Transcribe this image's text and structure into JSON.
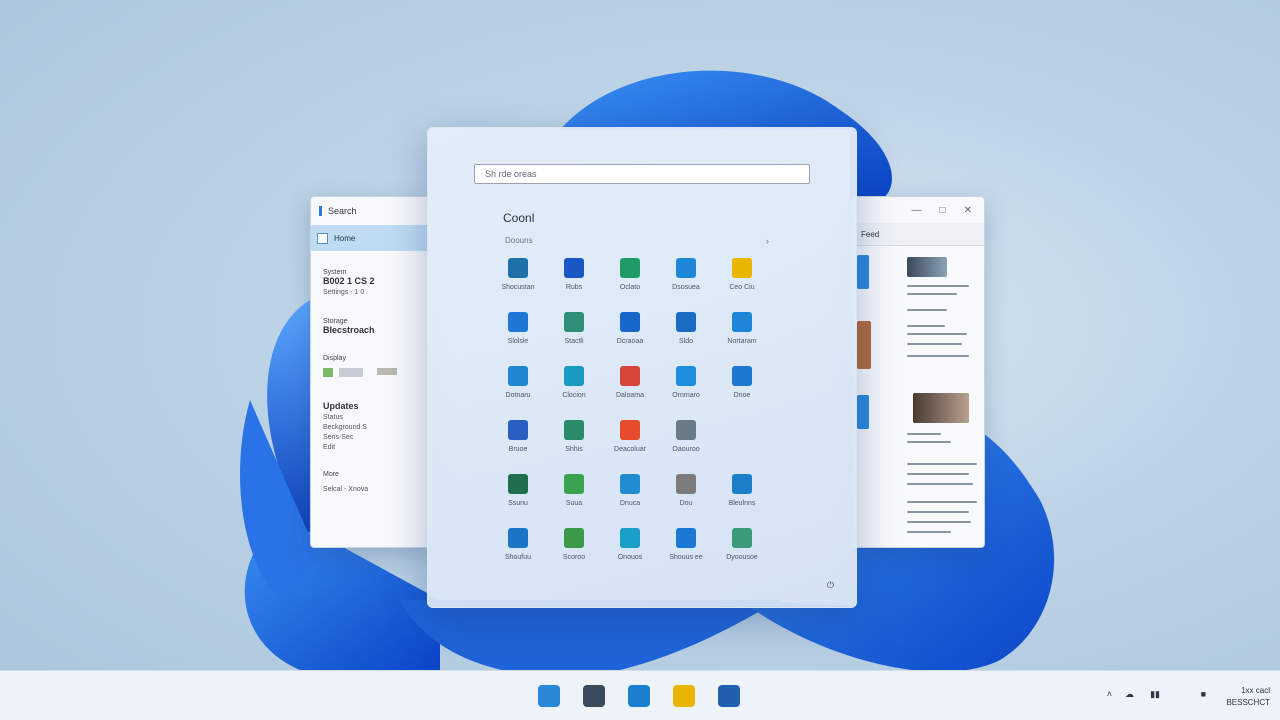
{
  "left_window": {
    "title": "Search",
    "selected_item": "Home",
    "section1_label": "System",
    "section1_value": "B002 1 CS 2",
    "section1_detail": "Settings - 1 0",
    "section2_label": "Storage",
    "section2_value": "Blecstroach",
    "section3_label": "Display",
    "section4_label": "Updates",
    "section4_lines": [
      "Status",
      "Beckground S",
      "Sens-Sec",
      "Edit"
    ],
    "section5_label": "More",
    "footer_text": "Selcal - Xnova"
  },
  "right_window": {
    "tab_label": "Feed",
    "controls": [
      "—",
      "□",
      "✕"
    ]
  },
  "start_menu": {
    "search_placeholder": "Sh rde oreas",
    "pinned_title": "Coonl",
    "pinned_subtitle": "Doouns",
    "all_apps": "›",
    "apps": [
      {
        "label": "Shocustan",
        "color": "#1f6fa8",
        "icon": "store-icon"
      },
      {
        "label": "Rubs",
        "color": "#1b57c4",
        "icon": "grid-icon"
      },
      {
        "label": "Oclato",
        "color": "#1f9a67",
        "icon": "photos-icon"
      },
      {
        "label": "Dsosuea",
        "color": "#1e86d6",
        "icon": "star-icon"
      },
      {
        "label": "Ceo Ciu",
        "color": "#e9b500",
        "icon": "folder-icon"
      },
      {
        "label": "Slolsle",
        "color": "#1d78d4",
        "icon": "tiles-icon"
      },
      {
        "label": "Stactli",
        "color": "#2f8f76",
        "icon": "landscape-icon"
      },
      {
        "label": "Dcraoaa",
        "color": "#1766c9",
        "icon": "phone-icon"
      },
      {
        "label": "Sldo",
        "color": "#1a6bc2",
        "icon": "monitor-icon"
      },
      {
        "label": "Nortaram",
        "color": "#1d86d8",
        "icon": "files-icon"
      },
      {
        "label": "Dotnaru",
        "color": "#1f86d4",
        "icon": "mail-icon"
      },
      {
        "label": "Clocion",
        "color": "#1a9ac0",
        "icon": "compass-icon"
      },
      {
        "label": "Daloama",
        "color": "#d6453a",
        "icon": "calendar-icon"
      },
      {
        "label": "Ornmaro",
        "color": "#1e8fe0",
        "icon": "edge-icon"
      },
      {
        "label": "Dnoe",
        "color": "#1b79d2",
        "icon": "cloud-icon"
      },
      {
        "label": "Bruoe",
        "color": "#2a5ec0",
        "icon": "moon-icon"
      },
      {
        "label": "Shhis",
        "color": "#2a8a6a",
        "icon": "gallery-icon"
      },
      {
        "label": "Deacoluar",
        "color": "#e54c2c",
        "icon": "chrome-icon"
      },
      {
        "label": "Oaouroo",
        "color": "#6a7b88",
        "icon": "camera-icon"
      },
      {
        "label": "",
        "color": "",
        "icon": ""
      },
      {
        "label": "Ssunu",
        "color": "#1f6e4e",
        "icon": "book-icon"
      },
      {
        "label": "Suua",
        "color": "#3aa250",
        "icon": "notes-icon"
      },
      {
        "label": "Dnuca",
        "color": "#1f8bd0",
        "icon": "chat-icon"
      },
      {
        "label": "Dou",
        "color": "#7c7c7c",
        "icon": "clock-icon"
      },
      {
        "label": "Bleulnns",
        "color": "#1b7fc9",
        "icon": "doc-icon"
      },
      {
        "label": "Shoufuu",
        "color": "#1b74c7",
        "icon": "settings-icon"
      },
      {
        "label": "Scoroo",
        "color": "#3a9a47",
        "icon": "paint-icon"
      },
      {
        "label": "Onouos",
        "color": "#1a9fc9",
        "icon": "globe-icon"
      },
      {
        "label": "Shouus ee",
        "color": "#1a78d4",
        "icon": "weather-icon"
      },
      {
        "label": "Dyoousoe",
        "color": "#3a9a7a",
        "icon": "maps-icon"
      }
    ],
    "power_icon": "⏻"
  },
  "taskbar": {
    "icons": [
      {
        "name": "start-icon",
        "color": "#2a88d8"
      },
      {
        "name": "photos-app-icon",
        "color": "#3a4a5a"
      },
      {
        "name": "edge-app-icon",
        "color": "#1d7fcf"
      },
      {
        "name": "explorer-app-icon",
        "color": "#e9b500"
      },
      {
        "name": "store-app-icon",
        "color": "#2160b0"
      }
    ],
    "tray": [
      "˄",
      "☁",
      "▮▮",
      "■"
    ],
    "time": "1xx cacl",
    "date": "BESSCHCT"
  }
}
